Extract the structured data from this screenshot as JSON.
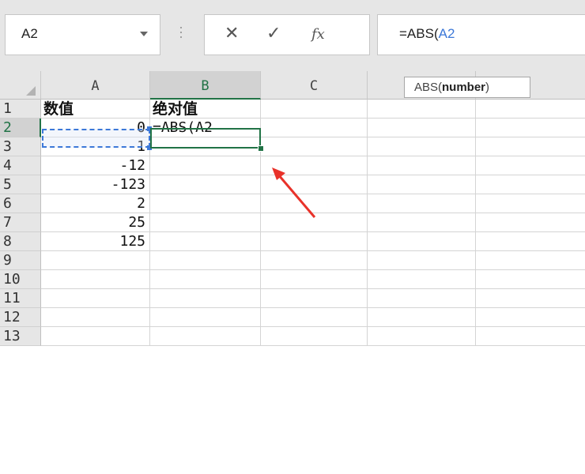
{
  "formula_bar": {
    "name_box": "A2",
    "cancel_icon": "✕",
    "enter_icon": "✓",
    "fx_icon": "fx",
    "formula_prefix": "=ABS(",
    "formula_ref": "A2"
  },
  "tooltip": {
    "func": "ABS(",
    "arg": "number",
    "close": ")"
  },
  "columns": [
    "A",
    "B",
    "C"
  ],
  "active_column": "B",
  "rows": [
    {
      "num": "1",
      "a": "数值",
      "b": "绝对值"
    },
    {
      "num": "2",
      "a": "0",
      "b": "=ABS(A2"
    },
    {
      "num": "3",
      "a": "-1",
      "b": ""
    },
    {
      "num": "4",
      "a": "-12",
      "b": ""
    },
    {
      "num": "5",
      "a": "-123",
      "b": ""
    },
    {
      "num": "6",
      "a": "2",
      "b": ""
    },
    {
      "num": "7",
      "a": "25",
      "b": ""
    },
    {
      "num": "8",
      "a": "125",
      "b": ""
    },
    {
      "num": "9",
      "a": "",
      "b": ""
    },
    {
      "num": "10",
      "a": "",
      "b": ""
    },
    {
      "num": "11",
      "a": "",
      "b": ""
    },
    {
      "num": "12",
      "a": "",
      "b": ""
    },
    {
      "num": "13",
      "a": "",
      "b": ""
    }
  ],
  "colors": {
    "selection_green": "#217346",
    "reference_blue": "#3c78d8",
    "annotation_arrow": "#e8322a"
  }
}
